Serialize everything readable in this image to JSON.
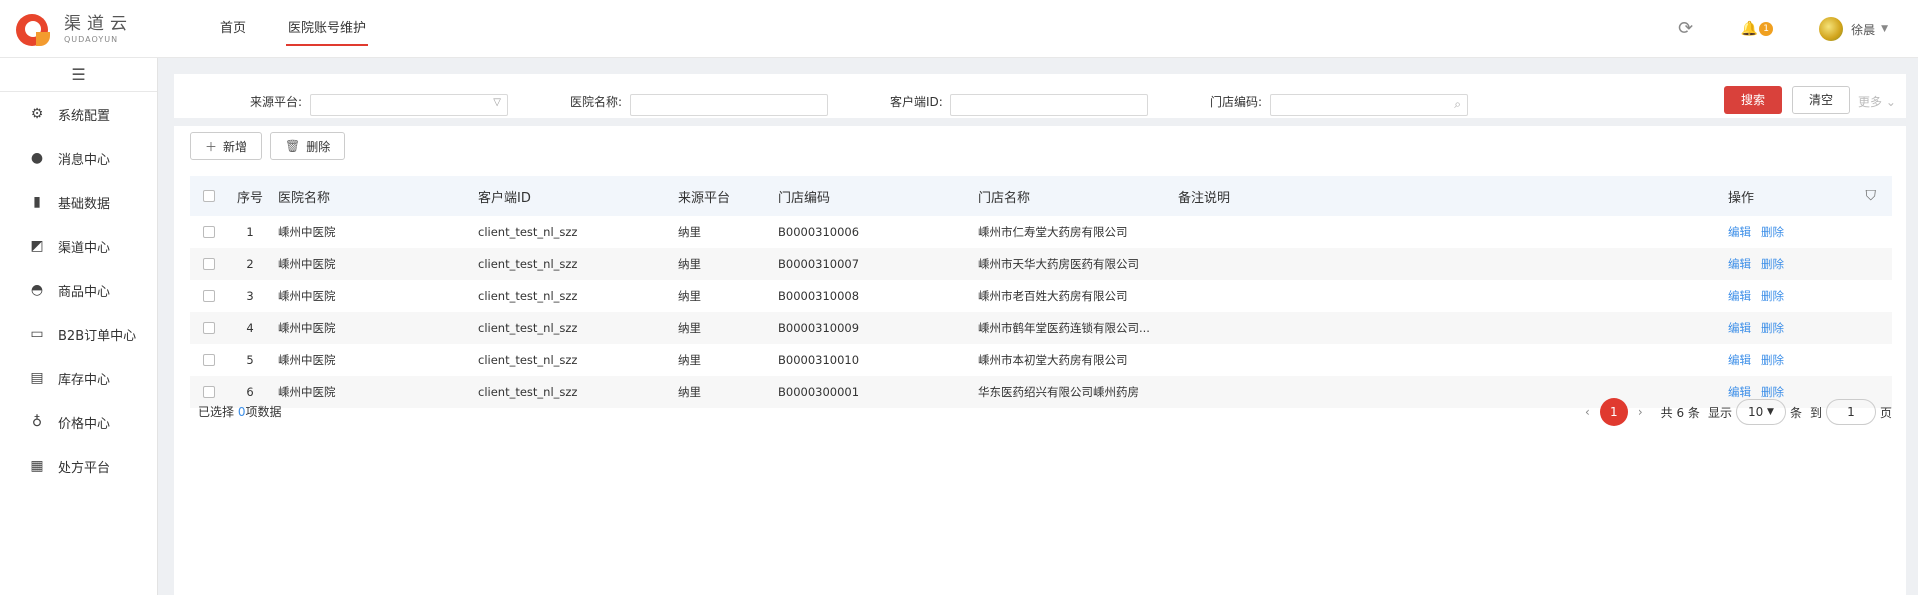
{
  "brand": {
    "name_cn": "渠道云",
    "name_en": "QUDAOYUN"
  },
  "topnav": {
    "items": [
      "首页",
      "医院账号维护"
    ],
    "active_index": 1
  },
  "header": {
    "notification_count": "1",
    "username": "徐晨",
    "refresh_icon": "refresh-icon",
    "bell_icon": "bell-icon"
  },
  "sidebar": {
    "items": [
      {
        "label": "系统配置",
        "icon": "gear-icon"
      },
      {
        "label": "消息中心",
        "icon": "chat-icon"
      },
      {
        "label": "基础数据",
        "icon": "bar-chart-icon"
      },
      {
        "label": "渠道中心",
        "icon": "channel-icon"
      },
      {
        "label": "商品中心",
        "icon": "car-icon"
      },
      {
        "label": "B2B订单中心",
        "icon": "order-icon"
      },
      {
        "label": "库存中心",
        "icon": "warehouse-icon"
      },
      {
        "label": "价格中心",
        "icon": "money-bag-icon"
      },
      {
        "label": "处方平台",
        "icon": "grid-icon"
      }
    ]
  },
  "filters": {
    "source_platform_label": "来源平台:",
    "hospital_name_label": "医院名称:",
    "client_id_label": "客户端ID:",
    "store_code_label": "门店编码:",
    "search_button": "搜索",
    "clear_button": "清空",
    "more_link": "更多"
  },
  "toolbar": {
    "add_button": "新增",
    "delete_button": "删除"
  },
  "table": {
    "columns": [
      "序号",
      "医院名称",
      "客户端ID",
      "来源平台",
      "门店编码",
      "门店名称",
      "备注说明",
      "操作"
    ],
    "rows": [
      {
        "no": "1",
        "hospital": "嵊州中医院",
        "client_id": "client_test_nl_szz",
        "platform": "纳里",
        "store_code": "B0000310006",
        "store_name": "嵊州市仁寿堂大药房有限公司",
        "note": ""
      },
      {
        "no": "2",
        "hospital": "嵊州中医院",
        "client_id": "client_test_nl_szz",
        "platform": "纳里",
        "store_code": "B0000310007",
        "store_name": "嵊州市天华大药房医药有限公司",
        "note": ""
      },
      {
        "no": "3",
        "hospital": "嵊州中医院",
        "client_id": "client_test_nl_szz",
        "platform": "纳里",
        "store_code": "B0000310008",
        "store_name": "嵊州市老百姓大药房有限公司",
        "note": ""
      },
      {
        "no": "4",
        "hospital": "嵊州中医院",
        "client_id": "client_test_nl_szz",
        "platform": "纳里",
        "store_code": "B0000310009",
        "store_name": "嵊州市鹤年堂医药连锁有限公司...",
        "note": ""
      },
      {
        "no": "5",
        "hospital": "嵊州中医院",
        "client_id": "client_test_nl_szz",
        "platform": "纳里",
        "store_code": "B0000310010",
        "store_name": "嵊州市本初堂大药房有限公司",
        "note": ""
      },
      {
        "no": "6",
        "hospital": "嵊州中医院",
        "client_id": "client_test_nl_szz",
        "platform": "纳里",
        "store_code": "B0000300001",
        "store_name": "华东医药绍兴有限公司嵊州药房",
        "note": ""
      }
    ],
    "edit_label": "编辑",
    "delete_label": "删除"
  },
  "footer": {
    "selected_prefix": "已选择 ",
    "selected_count": "0",
    "selected_suffix": "项数据",
    "total_text": "共 6 条",
    "show_label": "显示",
    "page_size": "10",
    "per_unit": "条",
    "goto_label": "到",
    "goto_value": "1",
    "page_unit": "页",
    "current_page": "1"
  }
}
